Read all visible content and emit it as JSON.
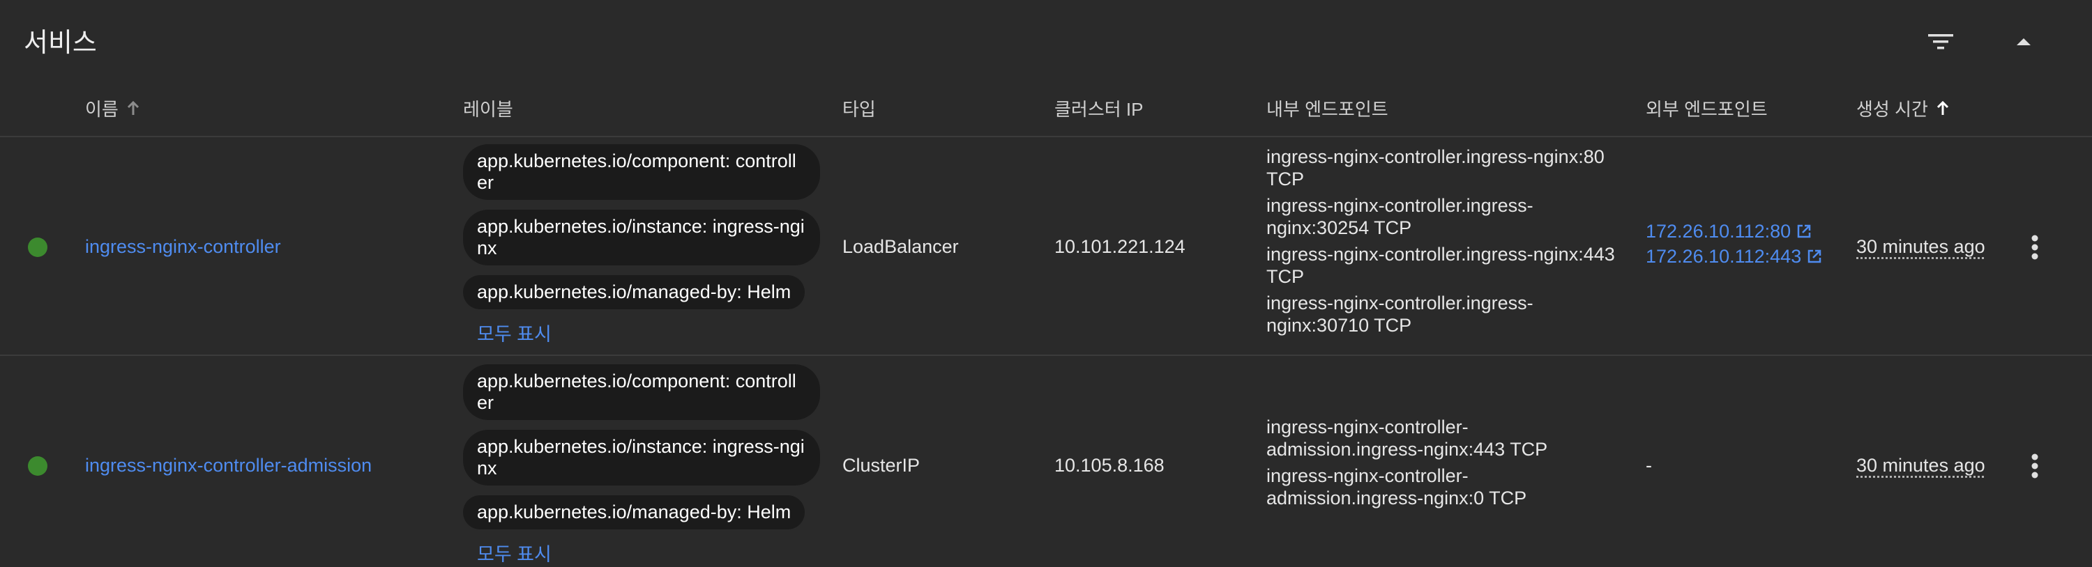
{
  "card": {
    "title": "서비스",
    "filter_icon": "filter-icon",
    "collapse_icon": "chevron-up-icon"
  },
  "columns": {
    "name": "이름",
    "labels": "레이블",
    "type": "타입",
    "cluster_ip": "클러스터 IP",
    "internal_endpoints": "내부 엔드포인트",
    "external_endpoints": "외부 엔드포인트",
    "created": "생성 시간"
  },
  "colors": {
    "status_ok": "#3c8a2e",
    "link": "#4f8cf0",
    "chip_bg": "#1b1b1b"
  },
  "rows": [
    {
      "name": "ingress-nginx-controller",
      "labels": [
        "app.kubernetes.io/component: controller",
        "app.kubernetes.io/instance: ingress-nginx",
        "app.kubernetes.io/managed-by: Helm"
      ],
      "show_all": "모두 표시",
      "type": "LoadBalancer",
      "cluster_ip": "10.101.221.124",
      "internal_endpoints": [
        "ingress-nginx-controller.ingress-nginx:80 TCP",
        "ingress-nginx-controller.ingress-nginx:30254 TCP",
        "ingress-nginx-controller.ingress-nginx:443 TCP",
        "ingress-nginx-controller.ingress-nginx:30710 TCP"
      ],
      "external_endpoints": [
        "172.26.10.112:80",
        "172.26.10.112:443"
      ],
      "created": "30 minutes ago"
    },
    {
      "name": "ingress-nginx-controller-admission",
      "labels": [
        "app.kubernetes.io/component: controller",
        "app.kubernetes.io/instance: ingress-nginx",
        "app.kubernetes.io/managed-by: Helm"
      ],
      "show_all": "모두 표시",
      "type": "ClusterIP",
      "cluster_ip": "10.105.8.168",
      "internal_endpoints": [
        "ingress-nginx-controller-admission.ingress-nginx:443 TCP",
        "ingress-nginx-controller-admission.ingress-nginx:0 TCP"
      ],
      "external_endpoint_none": "-",
      "created": "30 minutes ago"
    }
  ]
}
